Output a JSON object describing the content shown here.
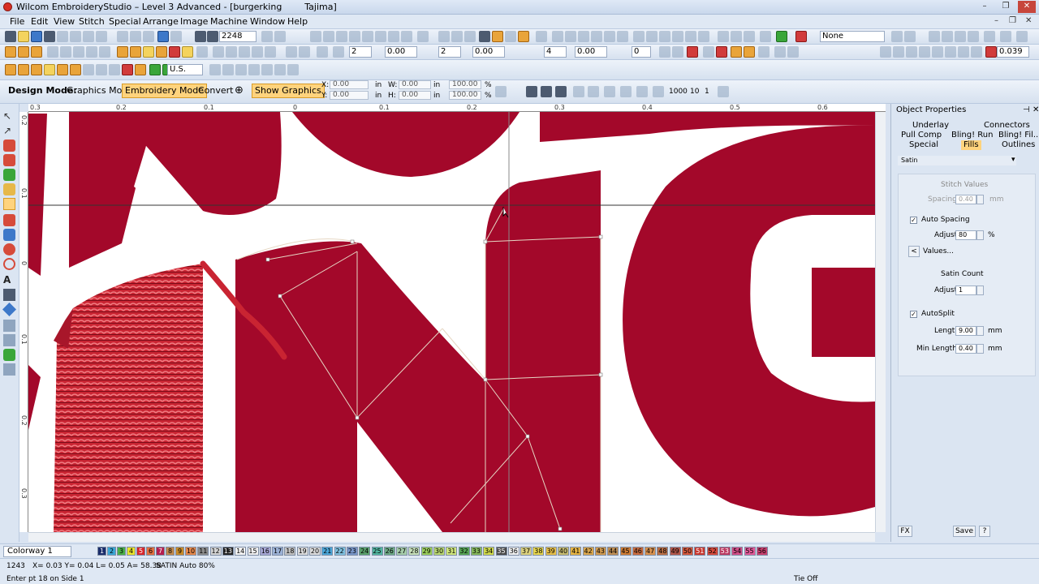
{
  "window": {
    "title": "Wilcom EmbroideryStudio – Level 3 Advanced - [burgerking        Tajima]",
    "controls": [
      "–",
      "❐",
      "✕"
    ],
    "mdi_controls": [
      "–",
      "❐",
      "✕"
    ]
  },
  "menu": [
    "File",
    "Edit",
    "View",
    "Stitch",
    "Special",
    "Arrange",
    "Image",
    "Machine",
    "Window",
    "Help"
  ],
  "toolbar1": {
    "stitch_count": "2248",
    "color_field": "None"
  },
  "toolbar2": {
    "units": "U.S.",
    "density": "0.039",
    "fields": [
      "2",
      "0.00",
      "2",
      "0.00",
      "4",
      "0.00",
      "0",
      "0"
    ]
  },
  "design_mode": {
    "label": "Design Mode:",
    "graphics_mode": "Graphics Mode",
    "embroidery_mode": "Embroidery Mode",
    "convert": "Convert",
    "show_graphics": "Show Graphics",
    "x_label": "X:",
    "x_value": "0.00",
    "x_unit": "in",
    "y_label": "Y:",
    "y_value": "0.00",
    "y_unit": "in",
    "w_label": "W:",
    "w_value": "0.00",
    "w_unit": "in",
    "h_label": "H:",
    "h_value": "0.00",
    "h_unit": "in",
    "pct1": "100.00",
    "pct2": "100.00",
    "pct_unit": "%",
    "extra_nums": [
      "1000",
      "10",
      "1"
    ]
  },
  "ruler_top": [
    "0.3",
    "0.2",
    "0.1",
    "0",
    "0.1",
    "0.2",
    "0.3",
    "0.4",
    "0.5",
    "0.6"
  ],
  "ruler_left": [
    "0.2",
    "0.1",
    "0",
    "0.1",
    "0.2",
    "0.3"
  ],
  "object_properties": {
    "title": "Object Properties",
    "tabs_row1": [
      "Underlay",
      "Connectors"
    ],
    "tabs_row2": [
      "Pull Comp",
      "Bling! Run",
      "Bling! Fil..."
    ],
    "tabs_row3": [
      "Special",
      "Fills",
      "Outlines"
    ],
    "fill_type": "Satin",
    "stitch_values": "Stitch Values",
    "spacing_label": "Spacing",
    "spacing_value": "0.40",
    "spacing_unit": "mm",
    "auto_spacing": "Auto Spacing",
    "adjust_label": "Adjust",
    "adjust_value": "80",
    "adjust_unit": "%",
    "values_btn": "Values...",
    "satin_count": "Satin Count",
    "adjust2_label": "Adjust",
    "adjust2_value": "1",
    "autosplit": "AutoSplit",
    "length_label": "Length",
    "length_value": "9.00",
    "length_unit": "mm",
    "min_length_label": "Min Length",
    "min_length_value": "0.40",
    "min_length_unit": "mm",
    "fx": "FX",
    "save": "Save",
    "help": "?"
  },
  "colorway": {
    "select": "Colorway 1",
    "swatches": [
      "1",
      "2",
      "3",
      "4",
      "5",
      "6",
      "7",
      "8",
      "9",
      "10",
      "11",
      "12",
      "13",
      "14",
      "15",
      "16",
      "17",
      "18",
      "19",
      "20",
      "21",
      "22",
      "23",
      "24",
      "25",
      "26",
      "27",
      "28",
      "29",
      "30",
      "31",
      "32",
      "33",
      "34",
      "35",
      "36",
      "37",
      "38",
      "39",
      "40",
      "41",
      "42",
      "43",
      "44",
      "45",
      "46",
      "47",
      "48",
      "49",
      "50",
      "51",
      "52",
      "53",
      "54",
      "55",
      "56"
    ],
    "swatch_colors": [
      "#1a2d6b",
      "#3aa7d6",
      "#49b048",
      "#e8e22b",
      "#d8262b",
      "#e36f3e",
      "#b51d4e",
      "#c28a4d",
      "#c98c2a",
      "#e6894c",
      "#8b8b8b",
      "#d4d4d4",
      "#222222",
      "#f2f2f2",
      "#efefef",
      "#a6a6d4",
      "#9bb1d6",
      "#c0c0c0",
      "#dcdcdc",
      "#dcdcdc",
      "#4aa6d9",
      "#7fc1e0",
      "#7896c9",
      "#59a06b",
      "#50b59f",
      "#6eaa86",
      "#a6cdaa",
      "#c8e1ba",
      "#9ccf5c",
      "#b8d770",
      "#d0e67c",
      "#57a454",
      "#86b85a",
      "#cfd84a",
      "#4b4b4b",
      "#efefef",
      "#ddd27d",
      "#e7d64f",
      "#e8c04a",
      "#c5ba6f",
      "#e3b243",
      "#d9a64d",
      "#d09a4f",
      "#bb8c53",
      "#cc7b35",
      "#c86b3f",
      "#d6904e",
      "#b86d44",
      "#b0564a",
      "#d3583d",
      "#c7362e",
      "#d64a3c",
      "#bc3a61",
      "#d14d87",
      "#e35a9a",
      "#c9406f"
    ]
  },
  "status": {
    "stitch": "1243",
    "coords": "X= 0.03 Y= 0.04 L= 0.05 A= 58.38",
    "info": "SATIN Auto 80%",
    "hint": "Enter pt 18 on Side 1",
    "tie": "Tie Off"
  },
  "colors": {
    "fill": "#a3082a",
    "thread": "#c92432"
  }
}
